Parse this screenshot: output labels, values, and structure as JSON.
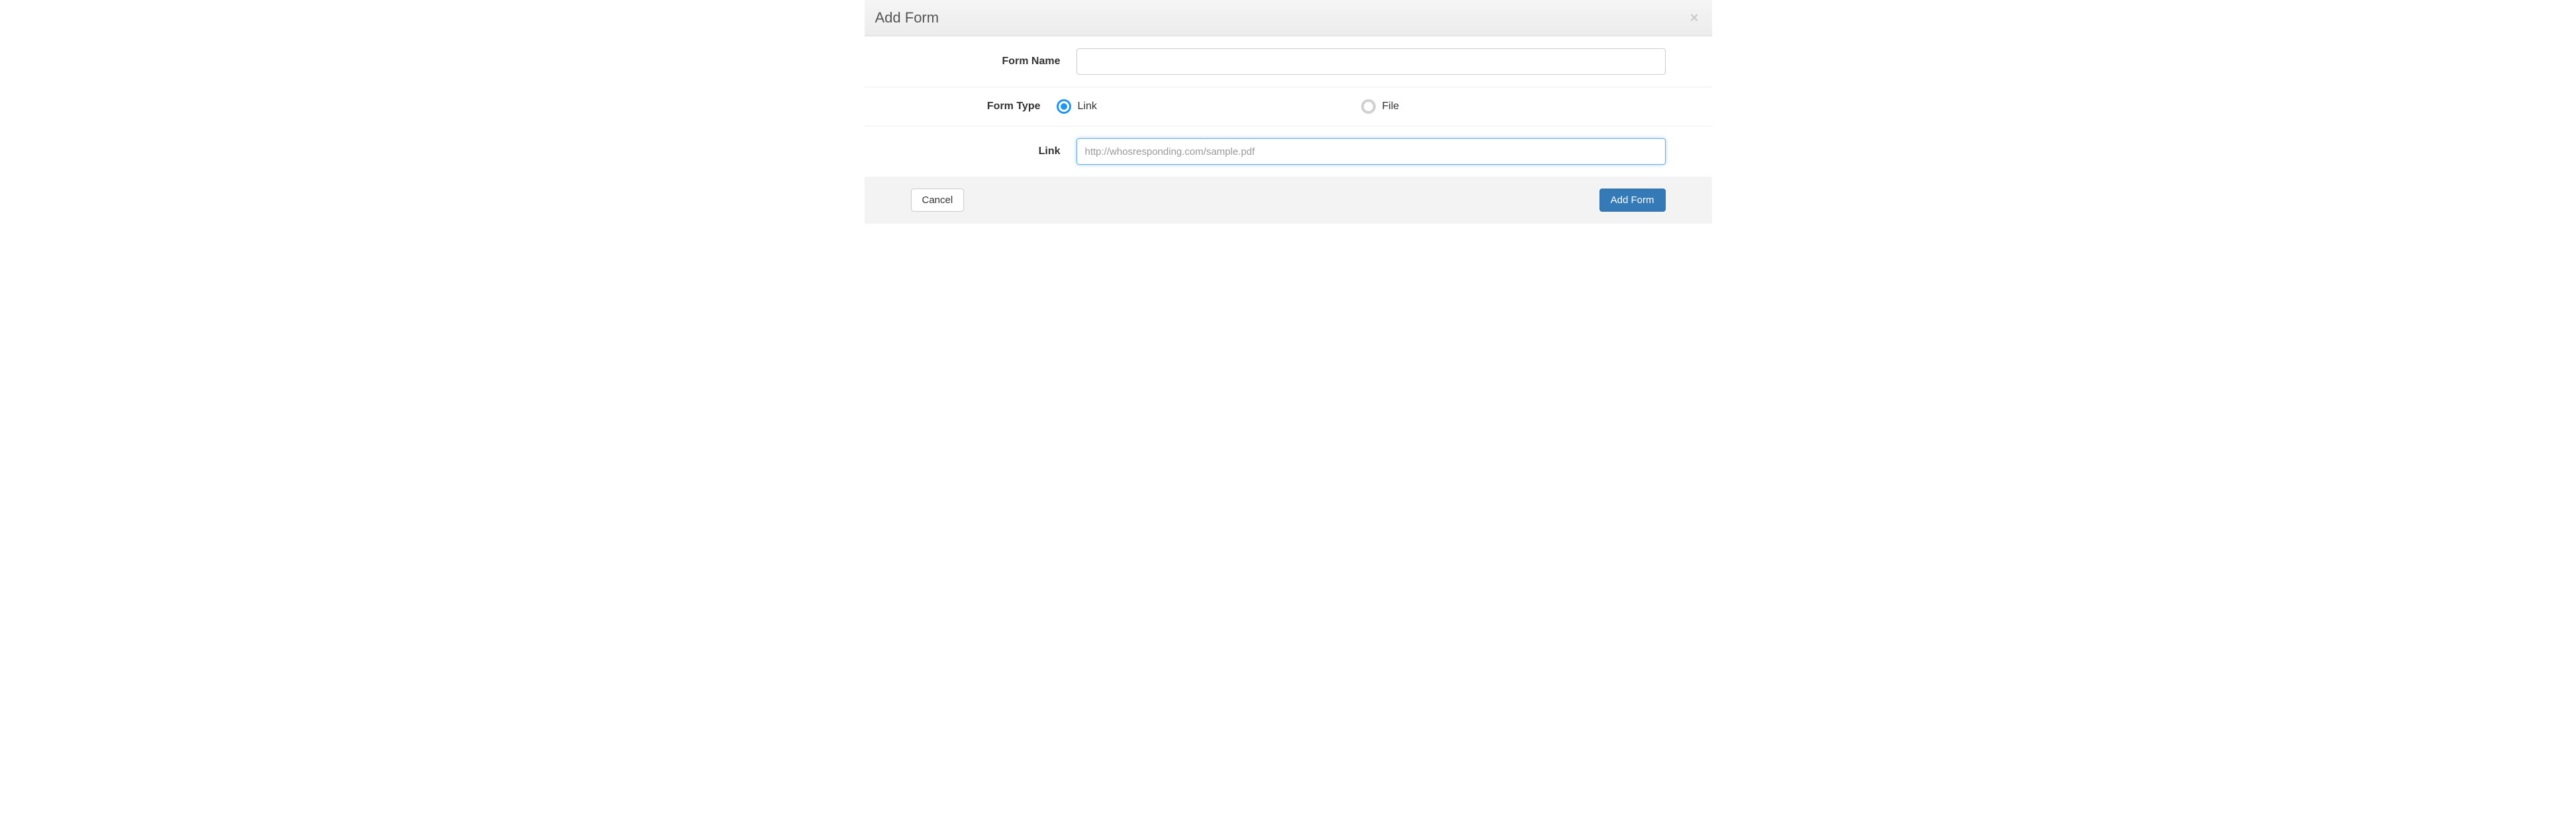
{
  "header": {
    "title": "Add Form",
    "close_icon": "×"
  },
  "fields": {
    "form_name": {
      "label": "Form Name",
      "value": "",
      "placeholder": ""
    },
    "form_type": {
      "label": "Form Type",
      "options": {
        "link": "Link",
        "file": "File"
      },
      "selected": "link"
    },
    "link": {
      "label": "Link",
      "value": "",
      "placeholder": "http://whosresponding.com/sample.pdf"
    }
  },
  "footer": {
    "cancel_label": "Cancel",
    "submit_label": "Add Form"
  }
}
